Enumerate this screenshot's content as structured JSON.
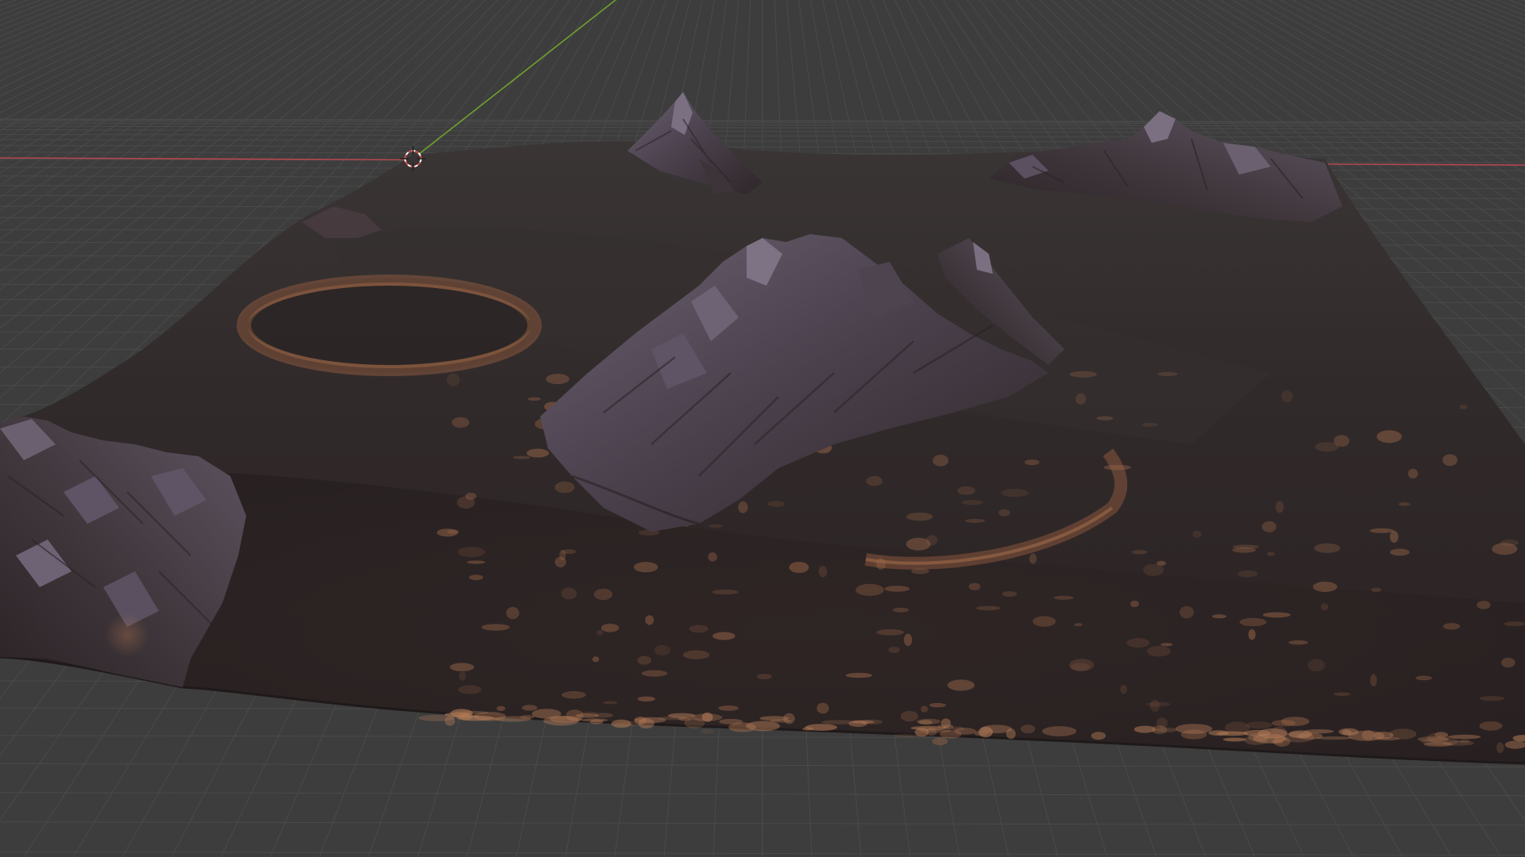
{
  "app": "3D Viewport",
  "viewport": {
    "background_color": "#3d3d3d",
    "grid_color": "#4a4a4a",
    "x_axis_color": "#b5474f",
    "y_axis_color": "#6fa22d",
    "cursor": "3d-cursor-icon",
    "terrain": {
      "base_color": "#2d2424",
      "rock_color": "#4a3d48",
      "highlight_color": "#a06a4a",
      "features": [
        "mountain-peak",
        "mountain-ridge",
        "central-mountain",
        "left-ridges",
        "crater-left",
        "crater-right"
      ]
    }
  }
}
